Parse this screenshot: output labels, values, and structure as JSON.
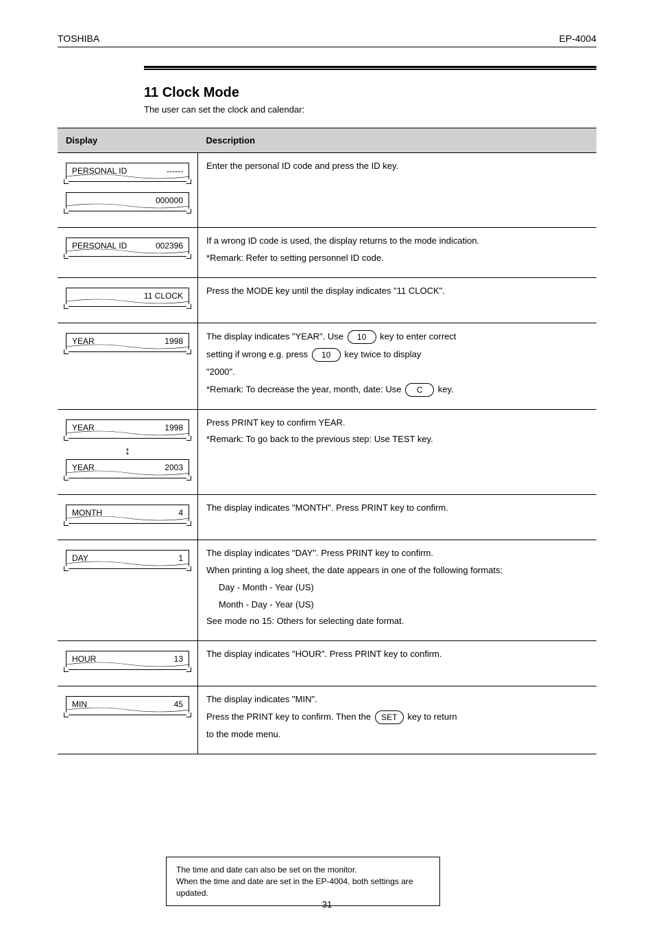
{
  "header": {
    "company": "TOSHIBA",
    "model": "EP-4004"
  },
  "rule_title": "11 Clock Mode",
  "rule_intro": "The user can set the clock and calendar:",
  "table": {
    "header_display": "Display",
    "header_desc": "Description",
    "rows": [
      {
        "lcd": [
          {
            "left": "PERSONAL ID",
            "right": "------"
          },
          {
            "left": "",
            "right": "000000"
          }
        ],
        "desc": [
          "Enter the personal ID code and press the ID key."
        ]
      },
      {
        "lcd": [
          {
            "left": "PERSONAL ID",
            "right": "002396"
          }
        ],
        "desc": [
          "If a wrong ID code is used, the display returns to the mode indication.",
          "*Remark: Refer to setting personnel ID code."
        ]
      },
      {
        "lcd": [
          {
            "left": "",
            "right": "11 CLOCK"
          }
        ],
        "desc": [
          "Press the MODE key until the display indicates \"11 CLOCK\"."
        ]
      },
      {
        "lcd": [
          {
            "left": "YEAR",
            "right": "1998"
          }
        ],
        "desc_with_keys": {
          "line1_before": "The display indicates \"YEAR\". Use",
          "line1_key": "10",
          "line1_after": "key to enter correct",
          "line2_before": "setting if wrong e.g. press",
          "line2_key": "10",
          "line2_after": "key twice to display",
          "line3": "\"2000\".",
          "line4_before": "*Remark: To decrease the year, month, date: Use",
          "line4_key": "C",
          "line4_after": "key."
        }
      },
      {
        "lcd": [
          {
            "left": "YEAR",
            "right": "1998"
          },
          {
            "left": "YEAR",
            "right": "2003"
          }
        ],
        "between_arrow": "↕",
        "desc": [
          "Press PRINT key to confirm YEAR.",
          "*Remark: To go back to the previous step: Use TEST key."
        ]
      },
      {
        "lcd": [
          {
            "left": "MONTH",
            "right": "4"
          }
        ],
        "desc": [
          "The display indicates \"MONTH\". Press PRINT key to confirm."
        ]
      },
      {
        "lcd": [
          {
            "left": "DAY",
            "right": "1"
          }
        ],
        "desc": [
          "The display indicates \"DAY\". Press PRINT key to confirm.",
          "When printing a log sheet, the date appears in one of the following formats:",
          "Day - Month - Year (US)",
          "Month - Day - Year (US)",
          "See mode no 15: Others for selecting date format."
        ],
        "indent_from": 2
      },
      {
        "lcd": [
          {
            "left": "HOUR",
            "right": "13"
          }
        ],
        "desc": [
          "The display indicates \"HOUR\". Press PRINT key to confirm."
        ]
      },
      {
        "lcd": [
          {
            "left": "MIN",
            "right": "45"
          }
        ],
        "desc_with_keys_2": {
          "line1": "The display indicates \"MIN\".",
          "line2_before": "Press the PRINT key to confirm. Then the",
          "line2_key": "SET",
          "line2_after": "key to return",
          "line3": "to the mode menu."
        }
      }
    ]
  },
  "note": {
    "line1": "The time and date can also be set on the monitor.",
    "line2": "When the time and date are set in the EP-4004, both settings are updated."
  },
  "page_number": "31"
}
